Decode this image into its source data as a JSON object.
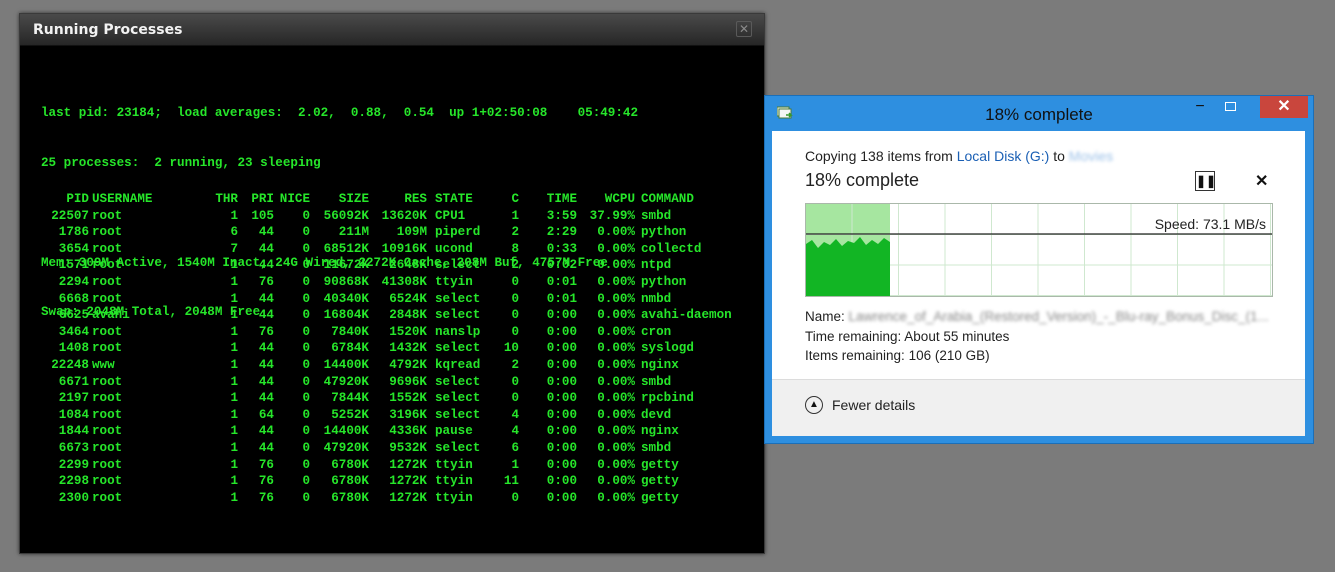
{
  "terminal": {
    "title": "Running Processes",
    "close_icon": "close-icon",
    "header_lines": [
      "last pid: 23184;  load averages:  2.02,  0.88,  0.54  up 1+02:50:08    05:49:42",
      "25 processes:  2 running, 23 sleeping"
    ],
    "mem_lines": [
      "Mem: 309M Active, 1540M Inact, 24G Wired, 2272K Cache, 208M Buf, 4757M Free",
      "Swap: 2048M Total, 2048M Free"
    ],
    "columns": [
      "PID",
      "USERNAME",
      "THR",
      "PRI",
      "NICE",
      "SIZE",
      "RES",
      "STATE",
      "C",
      "TIME",
      "WCPU",
      "COMMAND"
    ],
    "rows": [
      [
        "22507",
        "root",
        "1",
        "105",
        "0",
        "56092K",
        "13620K",
        "CPU1",
        "1",
        "3:59",
        "37.99%",
        "smbd"
      ],
      [
        "1786",
        "root",
        "6",
        "44",
        "0",
        "211M",
        "109M",
        "piperd",
        "2",
        "2:29",
        "0.00%",
        "python"
      ],
      [
        "3654",
        "root",
        "7",
        "44",
        "0",
        "68512K",
        "10916K",
        "ucond",
        "8",
        "0:33",
        "0.00%",
        "collectd"
      ],
      [
        "1571",
        "root",
        "1",
        "44",
        "0",
        "11672K",
        "2648K",
        "select",
        "2",
        "0:02",
        "0.00%",
        "ntpd"
      ],
      [
        "2294",
        "root",
        "1",
        "76",
        "0",
        "90868K",
        "41308K",
        "ttyin",
        "0",
        "0:01",
        "0.00%",
        "python"
      ],
      [
        "6668",
        "root",
        "1",
        "44",
        "0",
        "40340K",
        "6524K",
        "select",
        "0",
        "0:01",
        "0.00%",
        "nmbd"
      ],
      [
        "6625",
        "avahi",
        "1",
        "44",
        "0",
        "16804K",
        "2848K",
        "select",
        "0",
        "0:00",
        "0.00%",
        "avahi-daemon"
      ],
      [
        "3464",
        "root",
        "1",
        "76",
        "0",
        "7840K",
        "1520K",
        "nanslp",
        "0",
        "0:00",
        "0.00%",
        "cron"
      ],
      [
        "1408",
        "root",
        "1",
        "44",
        "0",
        "6784K",
        "1432K",
        "select",
        "10",
        "0:00",
        "0.00%",
        "syslogd"
      ],
      [
        "22248",
        "www",
        "1",
        "44",
        "0",
        "14400K",
        "4792K",
        "kqread",
        "2",
        "0:00",
        "0.00%",
        "nginx"
      ],
      [
        "6671",
        "root",
        "1",
        "44",
        "0",
        "47920K",
        "9696K",
        "select",
        "0",
        "0:00",
        "0.00%",
        "smbd"
      ],
      [
        "2197",
        "root",
        "1",
        "44",
        "0",
        "7844K",
        "1552K",
        "select",
        "0",
        "0:00",
        "0.00%",
        "rpcbind"
      ],
      [
        "1084",
        "root",
        "1",
        "64",
        "0",
        "5252K",
        "3196K",
        "select",
        "4",
        "0:00",
        "0.00%",
        "devd"
      ],
      [
        "1844",
        "root",
        "1",
        "44",
        "0",
        "14400K",
        "4336K",
        "pause",
        "4",
        "0:00",
        "0.00%",
        "nginx"
      ],
      [
        "6673",
        "root",
        "1",
        "44",
        "0",
        "47920K",
        "9532K",
        "select",
        "6",
        "0:00",
        "0.00%",
        "smbd"
      ],
      [
        "2299",
        "root",
        "1",
        "76",
        "0",
        "6780K",
        "1272K",
        "ttyin",
        "1",
        "0:00",
        "0.00%",
        "getty"
      ],
      [
        "2298",
        "root",
        "1",
        "76",
        "0",
        "6780K",
        "1272K",
        "ttyin",
        "11",
        "0:00",
        "0.00%",
        "getty"
      ],
      [
        "2300",
        "root",
        "1",
        "76",
        "0",
        "6780K",
        "1272K",
        "ttyin",
        "0",
        "0:00",
        "0.00%",
        "getty"
      ]
    ]
  },
  "copy_dialog": {
    "title": "18% complete",
    "app_icon": "file-copy-icon",
    "minimize_icon": "minimize-icon",
    "maximize_icon": "maximize-icon",
    "close_icon": "close-icon",
    "copy_prefix": "Copying 138 items from ",
    "source": "Local Disk (G:)",
    "to_word": " to ",
    "destination": "Movies",
    "progress_text": "18% complete",
    "progress_fraction": 0.18,
    "pause_icon": "pause-icon",
    "cancel_icon": "cancel-icon",
    "speed": "Speed: 73.1 MB/s",
    "name_label": "Name:",
    "name_value": "Lawrence_of_Arabia_(Restored_Version)_-_Blu-ray_Bonus_Disc_(1...",
    "time_label": "Time remaining:",
    "time_value": "About 55 minutes",
    "items_label": "Items remaining:",
    "items_value": "106 (210 GB)",
    "fewer_icon": "chevron-up-icon",
    "fewer_label": "Fewer details",
    "colors": {
      "title_bar": "#2e8fe0",
      "close_button": "#c9463d",
      "graph_fill": "#12b524",
      "graph_done": "#a6e6a0"
    }
  }
}
